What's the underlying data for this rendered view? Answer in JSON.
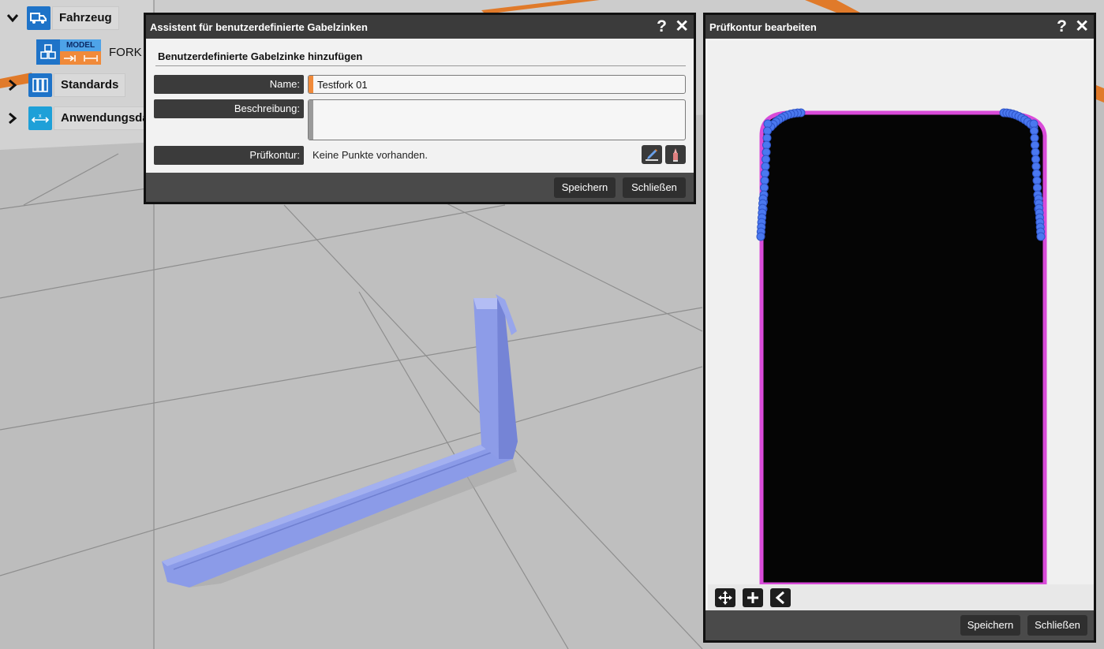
{
  "tree": {
    "vehicle_label": "Fahrzeug",
    "model_badge": "MODEL",
    "model_item_label": "FORK",
    "standards_label": "Standards",
    "application_label": "Anwendungsda"
  },
  "wizard": {
    "title": "Assistent für benutzerdefinierte Gabelzinken",
    "help": "?",
    "close": "✕",
    "section_title": "Benutzerdefinierte Gabelzinke hinzufügen",
    "name_label": "Name:",
    "name_value": "Testfork 01",
    "description_label": "Beschreibung:",
    "description_value": "",
    "contour_label": "Prüfkontur:",
    "contour_value": "Keine Punkte vorhanden.",
    "save_label": "Speichern",
    "close_label": "Schließen"
  },
  "contour_editor": {
    "title": "Prüfkontur bearbeiten",
    "help": "?",
    "close": "✕",
    "save_label": "Speichern",
    "close_label": "Schließen"
  },
  "colors": {
    "accent_orange": "#f08a3a",
    "contour_magenta": "#d94bd9",
    "contour_points": "#4a78f0",
    "fork_model": "#8b9be8"
  }
}
